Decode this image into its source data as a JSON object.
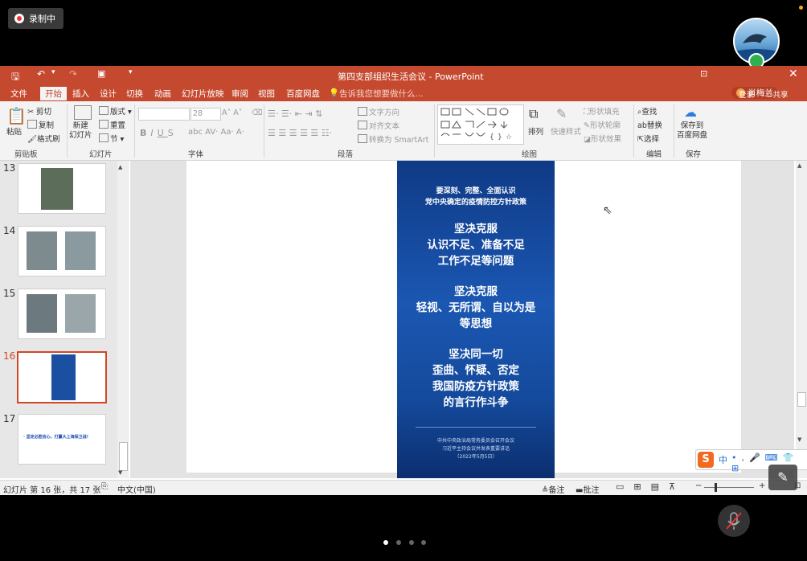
{
  "overlay": {
    "recording_label": "录制中",
    "user_name": "肖梅兰"
  },
  "window": {
    "title": "第四支部组织生活会议 - PowerPoint",
    "login": "登录",
    "share": "共享"
  },
  "tabs": [
    "文件",
    "开始",
    "插入",
    "设计",
    "切换",
    "动画",
    "幻灯片放映",
    "审阅",
    "视图",
    "百度网盘"
  ],
  "tell_me": "告诉我您想要做什么...",
  "ribbon": {
    "paste": "粘贴",
    "cut": "剪切",
    "copy": "复制",
    "format_painter": "格式刷",
    "clipboard_group": "剪贴板",
    "new_slide": "新建\n幻灯片",
    "layout": "版式",
    "reset": "重置",
    "section": "节",
    "slides_group": "幻灯片",
    "font_size": "28",
    "font_group": "字体",
    "text_direction": "文字方向",
    "align_text": "对齐文本",
    "convert_smartart": "转换为 SmartArt",
    "paragraph_group": "段落",
    "arrange": "排列",
    "quick_styles": "快速样式",
    "shape_fill": "形状填充",
    "shape_outline": "形状轮廓",
    "shape_effects": "形状效果",
    "drawing_group": "绘图",
    "find": "查找",
    "replace": "替换",
    "select": "选择",
    "editing_group": "编辑",
    "save_to_baidu": "保存到\n百度网盘",
    "save_group": "保存"
  },
  "thumbnails": [
    {
      "num": "13"
    },
    {
      "num": "14"
    },
    {
      "num": "15"
    },
    {
      "num": "16"
    },
    {
      "num": "17",
      "text": "· 坚定必胜信心，打赢大上海保卫战！"
    }
  ],
  "poster": {
    "head1": "要深刻、完整、全面认识",
    "head2": "党中央确定的疫情防控方针政策",
    "block1": [
      "坚决克服",
      "认识不足、准备不足",
      "工作不足等问题"
    ],
    "block2": [
      "坚决克服",
      "轻视、无所谓、自以为是",
      "等思想"
    ],
    "block3": [
      "坚决同一切",
      "歪曲、怀疑、否定",
      "我国防疫方针政策",
      "的言行作斗争"
    ],
    "foot": [
      "中共中央政治局常务委员会召开会议",
      "习近平主持会议并发表重要讲话",
      "（2022年5月5日）"
    ]
  },
  "status": {
    "slide_info": "幻灯片 第 16 张，共 17 张",
    "language": "中文(中国)",
    "notes": "备注",
    "comments": "批注"
  },
  "ime": {
    "lang": "中"
  },
  "colors": {
    "ppt_accent": "#c5492f",
    "poster_blue": "#1b57b2"
  }
}
